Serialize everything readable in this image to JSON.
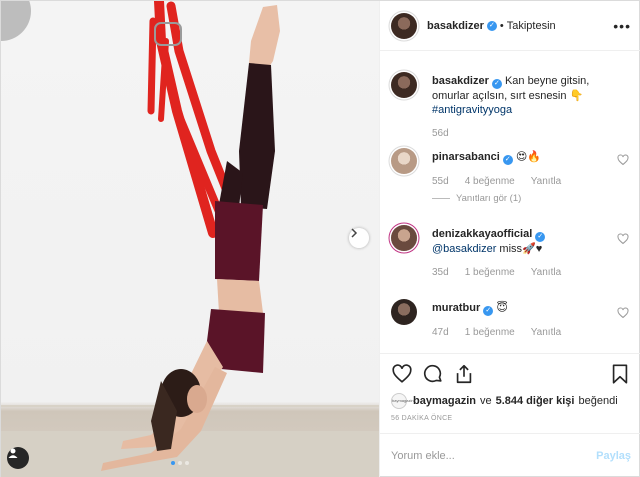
{
  "post": {
    "username": "basakdizer",
    "follow_status": "Takiptesin",
    "more": "•••"
  },
  "caption": {
    "username": "basakdizer",
    "text": "Kan beyne gitsin, omurlar açılsın, sırt esnesin 👇",
    "hashtag": "#antigravityyoga",
    "age": "56d"
  },
  "comments": [
    {
      "username": "pinarsabanci",
      "text": "😍🔥",
      "age": "55d",
      "likes": "4 beğenme",
      "reply": "Yanıtla",
      "view_replies": "Yanıtları gör (1)"
    },
    {
      "username": "denizakkayaofficial",
      "mention": "@basakdizer",
      "text": " miss🚀♥",
      "age": "35d",
      "likes": "1 beğenme",
      "reply": "Yanıtla"
    },
    {
      "username": "muratbur",
      "text": "😇",
      "age": "47d",
      "likes": "1 beğenme",
      "reply": "Yanıtla"
    }
  ],
  "likes": {
    "first_user": "baymagazin",
    "connector": "ve",
    "others": "5.844 diğer kişi",
    "suffix": "beğendi",
    "mini_avatar_text": "baymagazin"
  },
  "timestamp": "56 DAKİKA ÖNCE",
  "add_comment": {
    "placeholder": "Yorum ekle...",
    "post_label": "Paylaş"
  },
  "colors": {
    "accent": "#3897f0",
    "strap": "#e0241f",
    "outfit": "#5a1428"
  },
  "icons": [
    "heart-icon",
    "comment-icon",
    "share-icon",
    "bookmark-icon",
    "chevron-right-icon",
    "user-tag-icon",
    "verified-icon",
    "more-options-icon"
  ]
}
